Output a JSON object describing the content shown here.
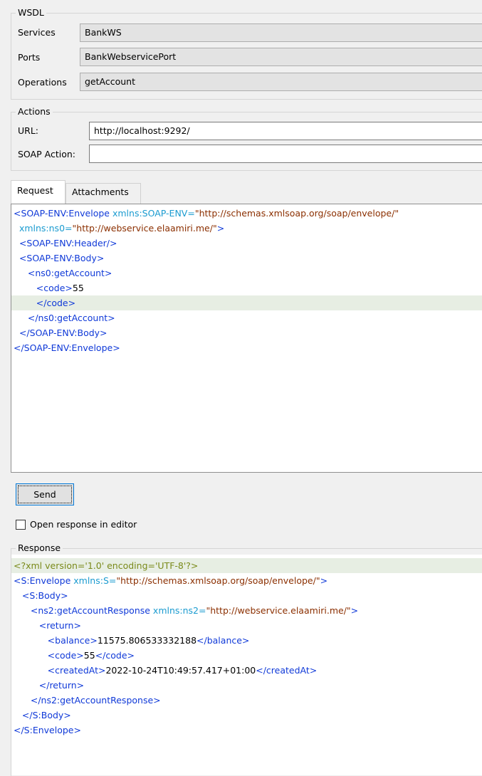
{
  "wsdl": {
    "title": "WSDL",
    "services_label": "Services",
    "services_value": "BankWS",
    "ports_label": "Ports",
    "ports_value": "BankWebservicePort",
    "operations_label": "Operations",
    "operations_value": "getAccount"
  },
  "actions": {
    "title": "Actions",
    "url_label": "URL:",
    "url_value": "http://localhost:9292/",
    "soap_action_label": "SOAP Action:",
    "soap_action_value": ""
  },
  "tabs": [
    {
      "label": "Request",
      "active": true
    },
    {
      "label": "Attachments",
      "active": false
    }
  ],
  "request": {
    "lines": [
      [
        {
          "k": "t",
          "s": "<SOAP-ENV:Envelope "
        },
        {
          "k": "a",
          "s": "xmlns:SOAP-ENV="
        },
        {
          "k": "v",
          "s": "\"http://schemas.xmlsoap.org/soap/envelope/\""
        }
      ],
      [
        {
          "k": "a",
          "s": "  xmlns:ns0="
        },
        {
          "k": "v",
          "s": "\"http://webservice.elaamiri.me/\""
        },
        {
          "k": "t",
          "s": ">"
        }
      ],
      [
        {
          "k": "t",
          "s": "  <SOAP-ENV:Header/>"
        }
      ],
      [
        {
          "k": "t",
          "s": "  <SOAP-ENV:Body>"
        }
      ],
      [
        {
          "k": "t",
          "s": "     <ns0:getAccount>"
        }
      ],
      [
        {
          "k": "t",
          "s": "        <code>"
        },
        {
          "k": "x",
          "s": "55"
        }
      ],
      [
        {
          "k": "t",
          "s": "        </code>"
        }
      ],
      [
        {
          "k": "t",
          "s": "     </ns0:getAccount>"
        }
      ],
      [
        {
          "k": "t",
          "s": "  </SOAP-ENV:Body>"
        }
      ],
      [
        {
          "k": "t",
          "s": "</SOAP-ENV:Envelope>"
        }
      ]
    ],
    "highlight_line": 6
  },
  "send_label": "Send",
  "open_in_editor_label": "Open response in editor",
  "open_in_editor_checked": false,
  "response": {
    "title": "Response",
    "lines": [
      [
        {
          "k": "pi",
          "s": "<?xml version='1.0' encoding='UTF-8'?>"
        }
      ],
      [
        {
          "k": "t",
          "s": "<S:Envelope "
        },
        {
          "k": "a",
          "s": "xmlns:S="
        },
        {
          "k": "v",
          "s": "\"http://schemas.xmlsoap.org/soap/envelope/\""
        },
        {
          "k": "t",
          "s": ">"
        }
      ],
      [
        {
          "k": "t",
          "s": "   <S:Body>"
        }
      ],
      [
        {
          "k": "t",
          "s": "      <ns2:getAccountResponse "
        },
        {
          "k": "a",
          "s": "xmlns:ns2="
        },
        {
          "k": "v",
          "s": "\"http://webservice.elaamiri.me/\""
        },
        {
          "k": "t",
          "s": ">"
        }
      ],
      [
        {
          "k": "t",
          "s": "         <return>"
        }
      ],
      [
        {
          "k": "t",
          "s": "            <balance>"
        },
        {
          "k": "x",
          "s": "11575.806533332188"
        },
        {
          "k": "t",
          "s": "</balance>"
        }
      ],
      [
        {
          "k": "t",
          "s": "            <code>"
        },
        {
          "k": "x",
          "s": "55"
        },
        {
          "k": "t",
          "s": "</code>"
        }
      ],
      [
        {
          "k": "t",
          "s": "            <createdAt>"
        },
        {
          "k": "x",
          "s": "2022-10-24T10:49:57.417+01:00"
        },
        {
          "k": "t",
          "s": "</createdAt>"
        }
      ],
      [
        {
          "k": "t",
          "s": "         </return>"
        }
      ],
      [
        {
          "k": "t",
          "s": "      </ns2:getAccountResponse>"
        }
      ],
      [
        {
          "k": "t",
          "s": "   </S:Body>"
        }
      ],
      [
        {
          "k": "t",
          "s": "</S:Envelope>"
        }
      ]
    ],
    "highlight_line": 0
  }
}
